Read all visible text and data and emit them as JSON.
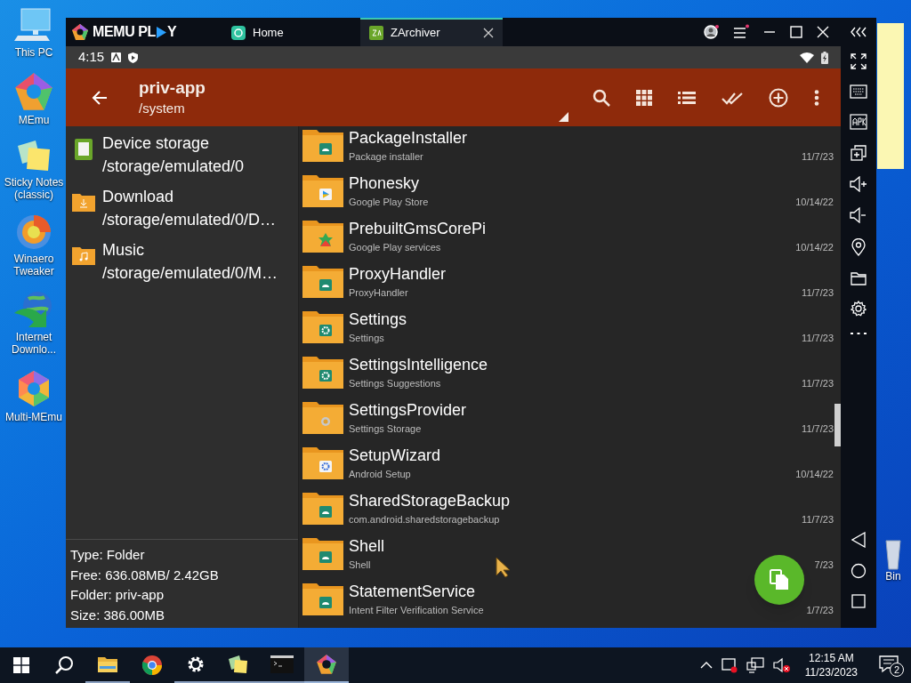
{
  "desktop_icons": [
    {
      "label": "This PC"
    },
    {
      "label": "MEmu"
    },
    {
      "label": "Sticky Notes (classic)"
    },
    {
      "label": "Winaero Tweaker"
    },
    {
      "label": "Internet Downlo..."
    },
    {
      "label": "Multi-MEmu"
    },
    {
      "label": "Bin"
    }
  ],
  "emulator": {
    "brand_left": "MEMU PL",
    "brand_right": "Y",
    "tabs": [
      {
        "label": "Home",
        "selected": false
      },
      {
        "label": "ZArchiver",
        "selected": true
      }
    ]
  },
  "status_bar": {
    "time": "4:15"
  },
  "app_bar": {
    "title": "priv-app",
    "subtitle": "/system"
  },
  "bookmarks": [
    {
      "kind": "storage",
      "name": "Device storage",
      "path": "/storage/emulated/0"
    },
    {
      "kind": "download",
      "name": "Download",
      "path": "/storage/emulated/0/D…"
    },
    {
      "kind": "music",
      "name": "Music",
      "path": "/storage/emulated/0/M…"
    }
  ],
  "info": [
    "Type: Folder",
    "Free: 636.08MB/ 2.42GB",
    "Folder: priv-app",
    "Size: 386.00MB"
  ],
  "files": [
    {
      "name": "PackageInstaller",
      "description": "Package installer",
      "date": "11/7/23",
      "kind": "android"
    },
    {
      "name": "Phonesky",
      "description": "Google Play Store",
      "date": "10/14/22",
      "kind": "play"
    },
    {
      "name": "PrebuiltGmsCorePi",
      "description": "Google Play services",
      "date": "10/14/22",
      "kind": "puzzle"
    },
    {
      "name": "ProxyHandler",
      "description": "ProxyHandler",
      "date": "11/7/23",
      "kind": "android"
    },
    {
      "name": "Settings",
      "description": "Settings",
      "date": "11/7/23",
      "kind": "gear"
    },
    {
      "name": "SettingsIntelligence",
      "description": "Settings Suggestions",
      "date": "11/7/23",
      "kind": "gear"
    },
    {
      "name": "SettingsProvider",
      "description": "Settings Storage",
      "date": "11/7/23",
      "kind": "graygear"
    },
    {
      "name": "SetupWizard",
      "description": "Android Setup",
      "date": "10/14/22",
      "kind": "setup"
    },
    {
      "name": "SharedStorageBackup",
      "description": "com.android.sharedstoragebackup",
      "date": "11/7/23",
      "kind": "android"
    },
    {
      "name": "Shell",
      "description": "Shell",
      "date": "7/23",
      "kind": "android"
    },
    {
      "name": "StatementService",
      "description": "Intent Filter Verification Service",
      "date": "1/7/23",
      "kind": "android"
    }
  ],
  "taskbar": {
    "time": "12:15 AM",
    "date": "11/23/2023",
    "notifications": "2"
  }
}
